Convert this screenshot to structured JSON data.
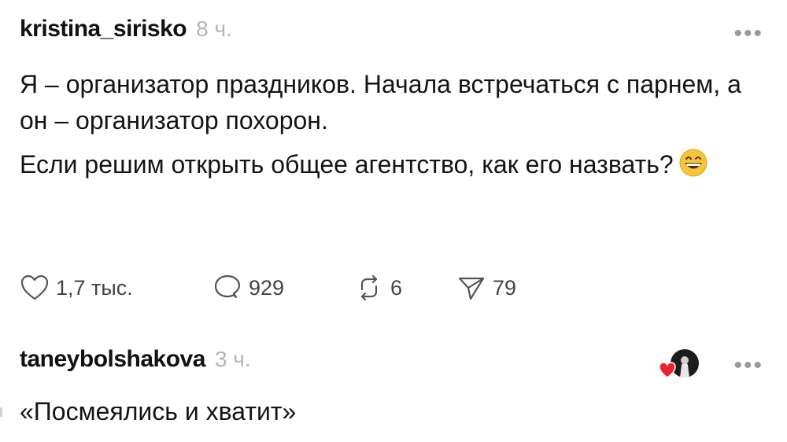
{
  "post": {
    "username": "kristina_sirisko",
    "time": "8 ч.",
    "more": "•••",
    "paragraph1": "Я – организатор праздников. Начала встречаться с парнем, а он – организатор похорон.",
    "paragraph2": "Если решим открыть общее агентство, как его назвать?",
    "emoji": "grinning-face-emoji"
  },
  "actions": {
    "likes": "1,7 тыс.",
    "comments": "929",
    "reposts": "6",
    "shares": "79"
  },
  "reply": {
    "username": "taneybolshakova",
    "time": "3 ч.",
    "more": "•••",
    "text": "«Посмеялись и хватит»"
  },
  "colors": {
    "text": "#141414",
    "muted": "#b5b5b5",
    "heart": "#e8232e",
    "emoji_yellow": "#f7c53a"
  }
}
